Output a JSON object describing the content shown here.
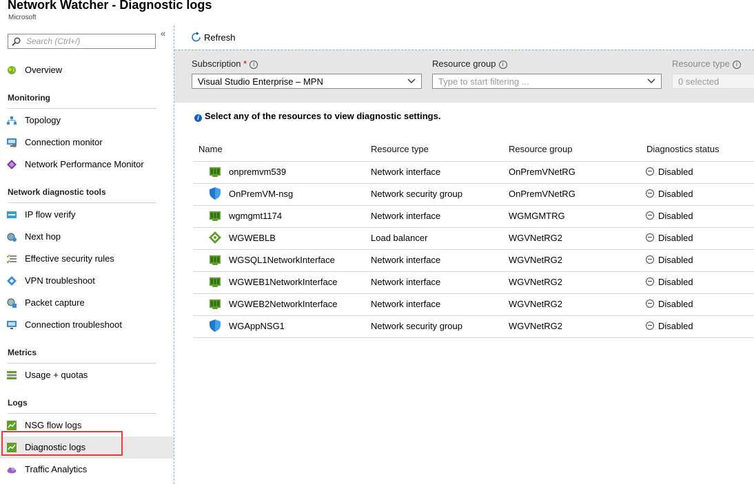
{
  "header": {
    "title": "Network Watcher - Diagnostic logs",
    "subtitle": "Microsoft"
  },
  "sidebar": {
    "collapse_glyph": "«",
    "search_placeholder": "Search (Ctrl+/)",
    "overview": "Overview",
    "sections": {
      "monitoring": "Monitoring",
      "tools": "Network diagnostic tools",
      "metrics": "Metrics",
      "logs": "Logs"
    },
    "items": {
      "topology": "Topology",
      "connection_monitor": "Connection monitor",
      "npm": "Network Performance Monitor",
      "ip_flow": "IP flow verify",
      "next_hop": "Next hop",
      "effective_rules": "Effective security rules",
      "vpn": "VPN troubleshoot",
      "packet": "Packet capture",
      "conn_troubleshoot": "Connection troubleshoot",
      "usage": "Usage + quotas",
      "nsg_logs": "NSG flow logs",
      "diag_logs": "Diagnostic logs",
      "traffic": "Traffic Analytics"
    },
    "selected": "Diagnostic logs"
  },
  "toolbar": {
    "refresh": "Refresh"
  },
  "filters": {
    "subscription_label": "Subscription",
    "required_mark": "*",
    "subscription_value": "Visual Studio Enterprise – MPN",
    "resource_group_label": "Resource group",
    "resource_group_placeholder": "Type to start filtering ...",
    "resource_type_label": "Resource type",
    "resource_type_value": "0 selected"
  },
  "info_message": "Select any of the resources to view diagnostic settings.",
  "table": {
    "columns": [
      "Name",
      "Resource type",
      "Resource group",
      "Diagnostics status"
    ],
    "rows": [
      {
        "name": "onpremvm539",
        "type": "Network interface",
        "group": "OnPremVNetRG",
        "status": "Disabled",
        "icon": "nic-icon"
      },
      {
        "name": "OnPremVM-nsg",
        "type": "Network security group",
        "group": "OnPremVNetRG",
        "status": "Disabled",
        "icon": "nsg-shield-icon"
      },
      {
        "name": "wgmgmt1174",
        "type": "Network interface",
        "group": "WGMGMTRG",
        "status": "Disabled",
        "icon": "nic-icon"
      },
      {
        "name": "WGWEBLB",
        "type": "Load balancer",
        "group": "WGVNetRG2",
        "status": "Disabled",
        "icon": "load-balancer-icon"
      },
      {
        "name": "WGSQL1NetworkInterface",
        "type": "Network interface",
        "group": "WGVNetRG2",
        "status": "Disabled",
        "icon": "nic-icon"
      },
      {
        "name": "WGWEB1NetworkInterface",
        "type": "Network interface",
        "group": "WGVNetRG2",
        "status": "Disabled",
        "icon": "nic-icon"
      },
      {
        "name": "WGWEB2NetworkInterface",
        "type": "Network interface",
        "group": "WGVNetRG2",
        "status": "Disabled",
        "icon": "nic-icon"
      },
      {
        "name": "WGAppNSG1",
        "type": "Network security group",
        "group": "WGVNetRG2",
        "status": "Disabled",
        "icon": "nsg-shield-icon"
      }
    ]
  },
  "colors": {
    "accent": "#0b63c5",
    "highlight": "#e33d3d",
    "filter_bg": "#e6e6e6",
    "nic_green": "#5ea02a"
  }
}
